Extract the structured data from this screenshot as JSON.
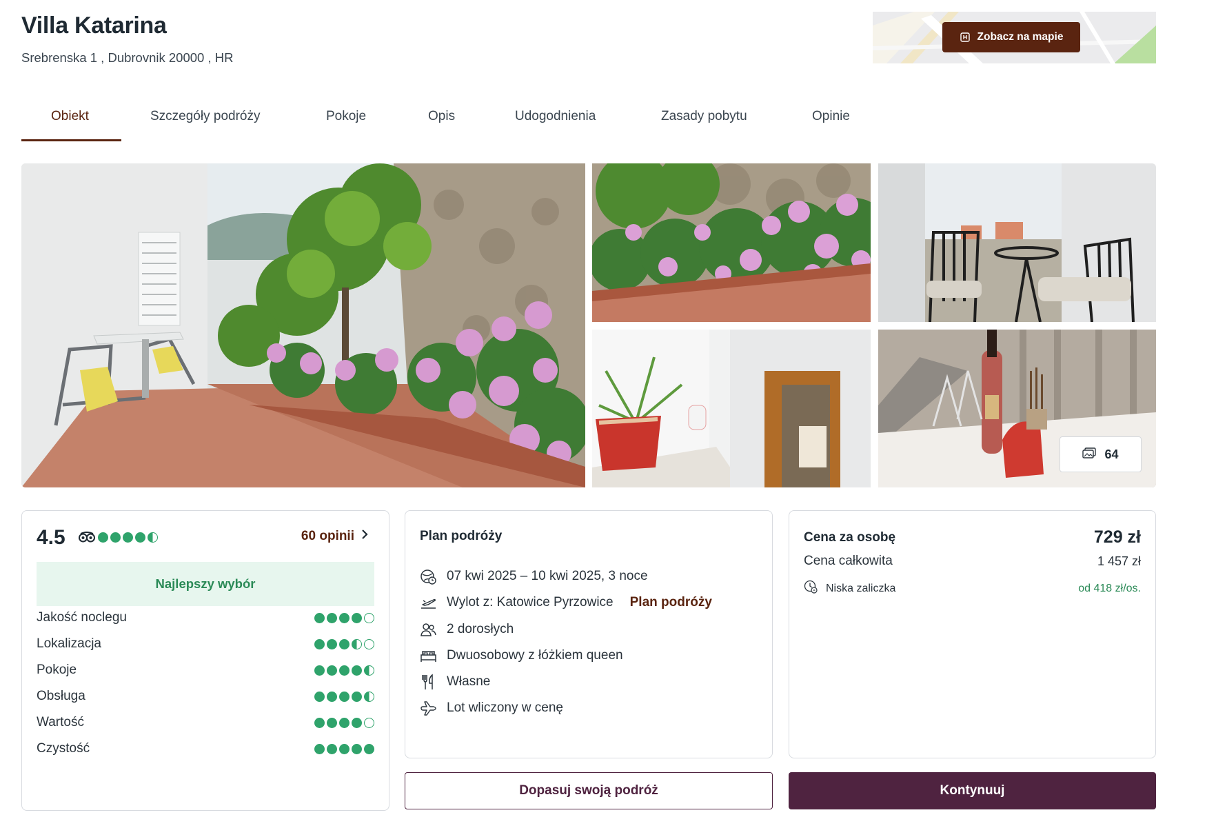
{
  "hotel": {
    "name": "Villa Katarina",
    "address": "Srebrenska 1 , Dubrovnik 20000 , HR"
  },
  "map": {
    "button_label": "Zobacz na mapie",
    "button_icon": "home-pin-icon"
  },
  "tabs": [
    {
      "label": "Obiekt",
      "active": true
    },
    {
      "label": "Szczegóły podróży",
      "active": false
    },
    {
      "label": "Pokoje",
      "active": false
    },
    {
      "label": "Opis",
      "active": false
    },
    {
      "label": "Udogodnienia",
      "active": false
    },
    {
      "label": "Zasady pobytu",
      "active": false
    },
    {
      "label": "Opinie",
      "active": false
    }
  ],
  "gallery": {
    "photo_count": "64",
    "photo_count_icon": "images-icon"
  },
  "rating": {
    "score": "4.5",
    "score_value": 4.5,
    "provider_icon": "tripadvisor-owl-icon",
    "reviews_label": "60 opinii",
    "best_choice": "Najlepszy wybór",
    "categories": [
      {
        "label": "Jakość noclegu",
        "value": 4
      },
      {
        "label": "Lokalizacja",
        "value": 3.5
      },
      {
        "label": "Pokoje",
        "value": 4.5
      },
      {
        "label": "Obsługa",
        "value": 4.5
      },
      {
        "label": "Wartość",
        "value": 4
      },
      {
        "label": "Czystość",
        "value": 5
      }
    ],
    "accent_color": "#2fa36b"
  },
  "plan": {
    "heading": "Plan podróży",
    "dates": "07 kwi 2025 – 10 kwi 2025, 3 noce",
    "flight": "Wylot z: Katowice Pyrzowice",
    "flight_link": "Plan podróży",
    "guests": "2 dorosłych",
    "room": "Dwuosobowy z łóżkiem queen",
    "board": "Własne",
    "flight_included": "Lot wliczony w cenę"
  },
  "price": {
    "per_person_label": "Cena za osobę",
    "per_person_value": "729 zł",
    "total_label": "Cena całkowita",
    "total_value": "1 457 zł",
    "deposit_label": "Niska zaliczka",
    "deposit_value": "od 418 zł/os."
  },
  "actions": {
    "customize": "Dopasuj swoją podróż",
    "continue": "Kontynuuj"
  },
  "colors": {
    "brand_brown": "#5a2410",
    "brand_plum": "#4f2340",
    "success_green": "#2b8a57"
  }
}
